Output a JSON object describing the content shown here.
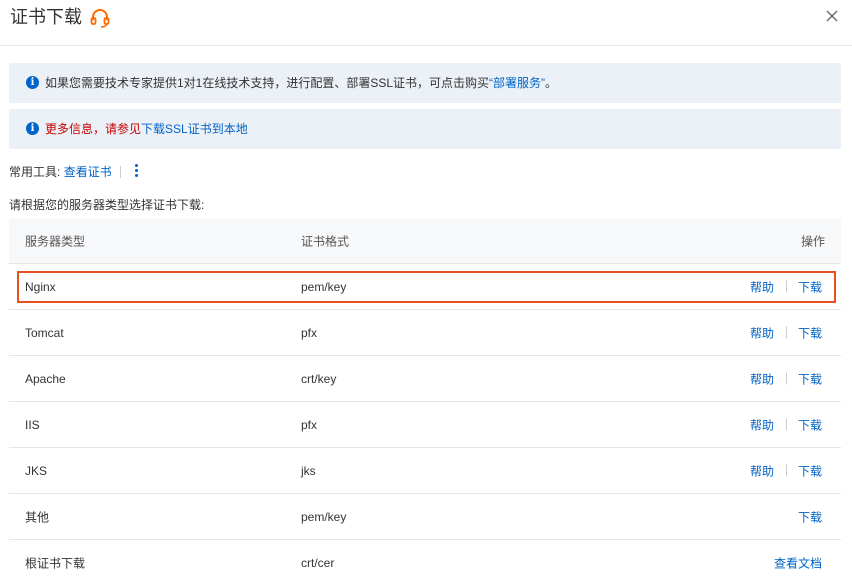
{
  "dialog": {
    "title": "证书下载",
    "close_label": "×"
  },
  "alerts": {
    "first": {
      "prefix": "如果您需要技术专家提供1对1在线技术支持，进行配置、部署SSL证书，可点击购买",
      "link": "“部署服务”",
      "suffix": "。"
    },
    "second": {
      "red_text": "更多信息，请参见",
      "link": "下载SSL证书到本地"
    }
  },
  "tools": {
    "label": "常用工具:",
    "link": "查看证书"
  },
  "prompt": "请根据您的服务器类型选择证书下载:",
  "table": {
    "headers": {
      "server": "服务器类型",
      "format": "证书格式",
      "action": "操作"
    },
    "rows": [
      {
        "server": "Nginx",
        "format": "pem/key",
        "help": "帮助",
        "download": "下载"
      },
      {
        "server": "Tomcat",
        "format": "pfx",
        "help": "帮助",
        "download": "下载"
      },
      {
        "server": "Apache",
        "format": "crt/key",
        "help": "帮助",
        "download": "下载"
      },
      {
        "server": "IIS",
        "format": "pfx",
        "help": "帮助",
        "download": "下载"
      },
      {
        "server": "JKS",
        "format": "jks",
        "help": "帮助",
        "download": "下载"
      },
      {
        "server": "其他",
        "format": "pem/key",
        "help": "",
        "download": "下载"
      },
      {
        "server": "根证书下载",
        "format": "crt/cer",
        "help": "",
        "download": "查看文档"
      }
    ]
  },
  "colors": {
    "link": "#0064c8",
    "highlight": "#e8511f",
    "alert_bg": "#ebf1f7",
    "warning": "#c80000"
  },
  "icons": {
    "title_icon": "headset-icon",
    "close": "close-icon",
    "info": "info-icon",
    "more": "more-vertical-icon"
  }
}
